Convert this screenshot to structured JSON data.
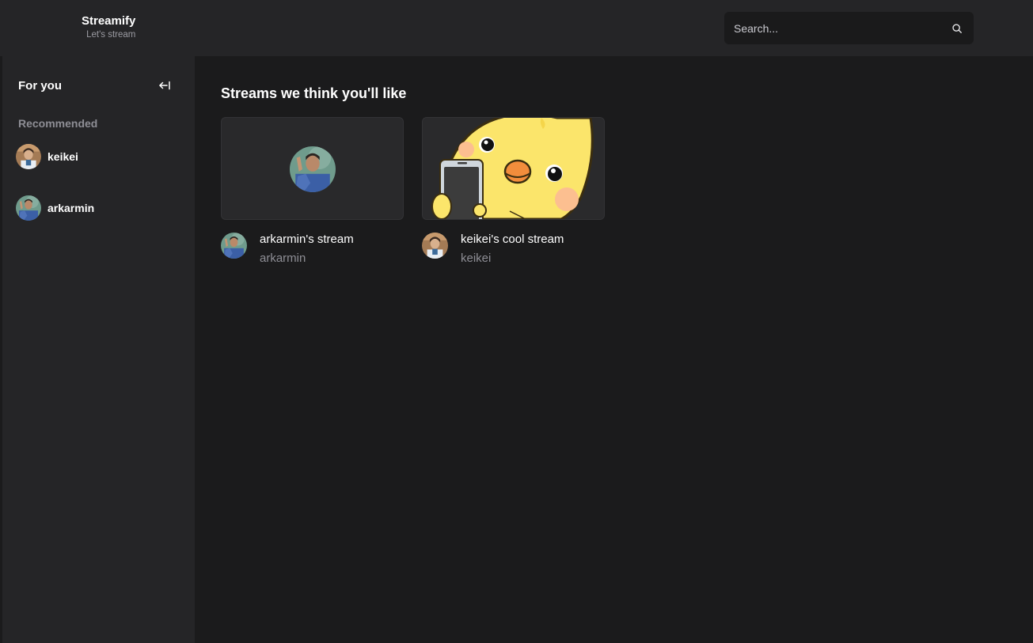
{
  "header": {
    "app_name": "Streamify",
    "tagline": "Let's stream",
    "search_placeholder": "Search..."
  },
  "sidebar": {
    "heading": "For you",
    "section_label": "Recommended",
    "users": [
      {
        "username": "keikei",
        "avatar": "keikei-avatar"
      },
      {
        "username": "arkarmin",
        "avatar": "arkarmin-avatar"
      }
    ]
  },
  "main": {
    "section_title": "Streams we think you'll like",
    "streams": [
      {
        "title": "arkarmin's stream",
        "username": "arkarmin",
        "thumbnail": "avatar-placeholder"
      },
      {
        "title": "keikei's cool stream",
        "username": "keikei",
        "thumbnail": "yellow-duck-with-phone"
      }
    ]
  },
  "colors": {
    "background": "#1b1b1c",
    "panel": "#252527",
    "search_bg": "#1a1a1b",
    "muted_text": "#8e8e95"
  }
}
